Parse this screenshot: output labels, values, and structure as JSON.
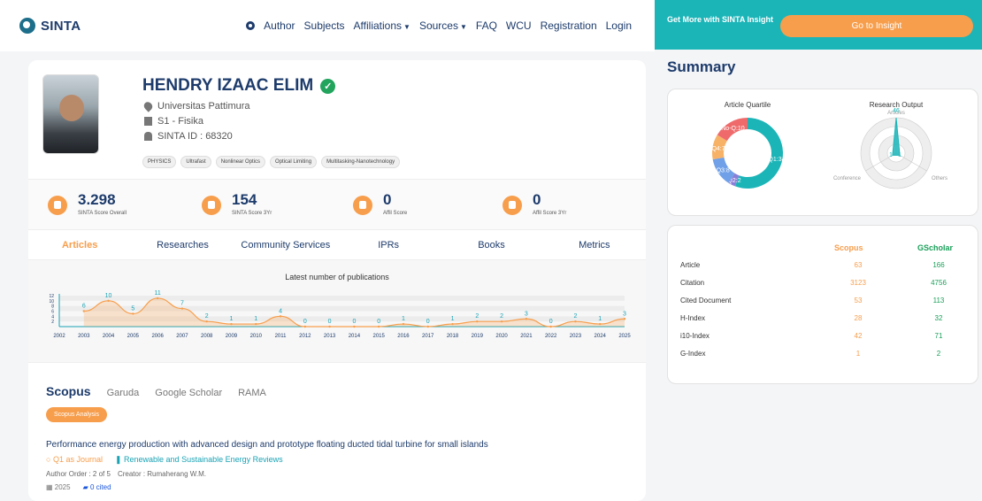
{
  "navbar": {
    "brand": "SINTA",
    "items": [
      "Author",
      "Subjects",
      "Affiliations",
      "Sources",
      "FAQ",
      "WCU",
      "Registration",
      "Login"
    ]
  },
  "insight": {
    "text": "Get More with SINTA Insight",
    "button": "Go to Insight"
  },
  "profile": {
    "name": "HENDRY IZAAC ELIM",
    "affiliation": "Universitas Pattimura",
    "department": "S1 - Fisika",
    "sinta_id": "SINTA ID : 68320",
    "tags": [
      "PHYSICS",
      "Ultrafast",
      "Nonlinear Optics",
      "Optical Limiting",
      "Multitasking-Nanotechnology"
    ]
  },
  "stats": [
    {
      "value": "3.298",
      "label": "SINTA Score Overall"
    },
    {
      "value": "154",
      "label": "SINTA Score 3Yr"
    },
    {
      "value": "0",
      "label": "Affil Score"
    },
    {
      "value": "0",
      "label": "Affil Score 3Yr"
    }
  ],
  "tabs": [
    "Articles",
    "Researches",
    "Community Services",
    "IPRs",
    "Books",
    "Metrics"
  ],
  "chart_data": {
    "type": "area",
    "title": "Latest number of publications",
    "categories": [
      "2002",
      "2003",
      "2004",
      "2005",
      "2006",
      "2007",
      "2008",
      "2009",
      "2010",
      "2011",
      "2012",
      "2013",
      "2014",
      "2015",
      "2016",
      "2017",
      "2018",
      "2019",
      "2020",
      "2021",
      "2022",
      "2023",
      "2024",
      "2025"
    ],
    "values": [
      null,
      6,
      10,
      5,
      11,
      7,
      2,
      1,
      1,
      4,
      0,
      0,
      0,
      0,
      1,
      0,
      1,
      2,
      2,
      3,
      0,
      2,
      1,
      3
    ],
    "ylim": [
      0,
      12
    ],
    "yticks": [
      2,
      4,
      6,
      8,
      10,
      12
    ],
    "color": "#f79e4c"
  },
  "sub_tabs": [
    "Scopus",
    "Garuda",
    "Google Scholar",
    "RAMA"
  ],
  "scopus_button": "Scopus Analysis",
  "publication": {
    "title": "Performance energy production with advanced design and prototype floating ducted tidal turbine for small islands",
    "quartile": "Q1 as Journal",
    "journal": "Renewable and Sustainable Energy Reviews",
    "author_order": "Author Order : 2 of 5",
    "creator": "Creator : Rumaherang W.M.",
    "year": "2025",
    "cited": "0 cited"
  },
  "summary": {
    "title": "Summary",
    "quartile_title": "Article Quartile",
    "output_title": "Research Output",
    "quartile": [
      {
        "label": "Q1:34",
        "value": 34,
        "color": "#1bb5b8"
      },
      {
        "label": "Q2:2",
        "value": 2,
        "color": "#8a7fd8"
      },
      {
        "label": "Q3:8",
        "value": 8,
        "color": "#6fa0e8"
      },
      {
        "label": "Q4:7",
        "value": 7,
        "color": "#f7b267"
      },
      {
        "label": "No-Q:10",
        "value": 10,
        "color": "#ef6b6b"
      }
    ],
    "radar": {
      "axes": [
        "Articles",
        "Others",
        "Conference"
      ],
      "values": [
        46,
        1,
        1
      ],
      "value_labels": [
        "46",
        "1",
        "1"
      ]
    }
  },
  "metrics": {
    "headers": [
      "Scopus",
      "GScholar"
    ],
    "rows": [
      {
        "label": "Article",
        "scopus": "63",
        "gscholar": "166"
      },
      {
        "label": "Citation",
        "scopus": "3123",
        "gscholar": "4756"
      },
      {
        "label": "Cited Document",
        "scopus": "53",
        "gscholar": "113"
      },
      {
        "label": "H-Index",
        "scopus": "28",
        "gscholar": "32"
      },
      {
        "label": "i10-Index",
        "scopus": "42",
        "gscholar": "71"
      },
      {
        "label": "G-Index",
        "scopus": "1",
        "gscholar": "2"
      }
    ]
  }
}
